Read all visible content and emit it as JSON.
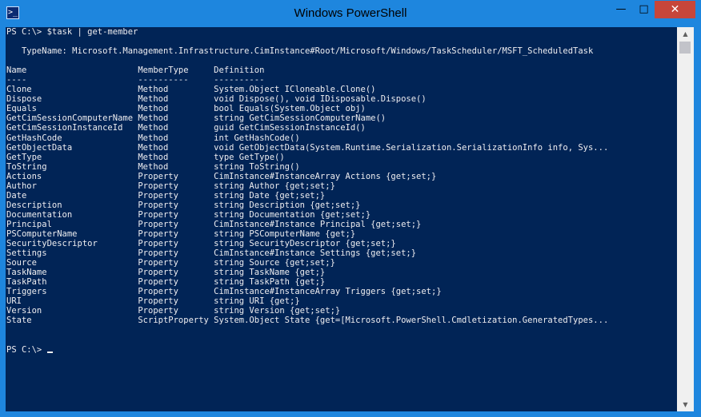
{
  "window": {
    "title": "Windows PowerShell",
    "app_icon_glyph": ">_",
    "minimize_glyph": "—",
    "maximize_glyph": "□",
    "close_glyph": "✕"
  },
  "colors": {
    "titlebar": "#1e86de",
    "console_bg": "#012456",
    "console_fg": "#eeedf0",
    "close_button": "#c7463a"
  },
  "console": {
    "command_line": "PS C:\\> $task | get-member",
    "type_name": "   TypeName: Microsoft.Management.Infrastructure.CimInstance#Root/Microsoft/Windows/TaskScheduler/MSFT_ScheduledTask",
    "header": "Name                      MemberType     Definition",
    "separator": "----                      ----------     ----------",
    "rows": [
      "Clone                     Method         System.Object ICloneable.Clone()",
      "Dispose                   Method         void Dispose(), void IDisposable.Dispose()",
      "Equals                    Method         bool Equals(System.Object obj)",
      "GetCimSessionComputerName Method         string GetCimSessionComputerName()",
      "GetCimSessionInstanceId   Method         guid GetCimSessionInstanceId()",
      "GetHashCode               Method         int GetHashCode()",
      "GetObjectData             Method         void GetObjectData(System.Runtime.Serialization.SerializationInfo info, Sys...",
      "GetType                   Method         type GetType()",
      "ToString                  Method         string ToString()",
      "Actions                   Property       CimInstance#InstanceArray Actions {get;set;}",
      "Author                    Property       string Author {get;set;}",
      "Date                      Property       string Date {get;set;}",
      "Description               Property       string Description {get;set;}",
      "Documentation             Property       string Documentation {get;set;}",
      "Principal                 Property       CimInstance#Instance Principal {get;set;}",
      "PSComputerName            Property       string PSComputerName {get;}",
      "SecurityDescriptor        Property       string SecurityDescriptor {get;set;}",
      "Settings                  Property       CimInstance#Instance Settings {get;set;}",
      "Source                    Property       string Source {get;set;}",
      "TaskName                  Property       string TaskName {get;}",
      "TaskPath                  Property       string TaskPath {get;}",
      "Triggers                  Property       CimInstance#InstanceArray Triggers {get;set;}",
      "URI                       Property       string URI {get;}",
      "Version                   Property       string Version {get;set;}",
      "State                     ScriptProperty System.Object State {get=[Microsoft.PowerShell.Cmdletization.GeneratedTypes..."
    ],
    "prompt": "PS C:\\> "
  },
  "scrollbar": {
    "up_glyph": "▲",
    "down_glyph": "▼"
  }
}
